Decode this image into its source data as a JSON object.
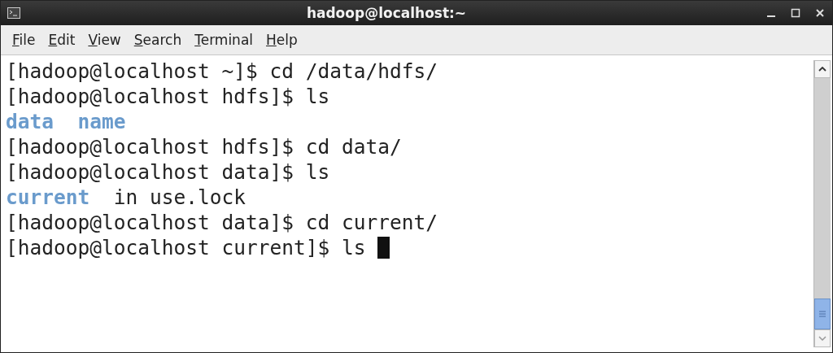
{
  "window": {
    "title": "hadoop@localhost:~"
  },
  "menu": [
    "File",
    "Edit",
    "View",
    "Search",
    "Terminal",
    "Help"
  ],
  "terminal": {
    "lines": [
      {
        "kind": "command",
        "text": "[hadoop@localhost ~]$ cd /data/hdfs/"
      },
      {
        "kind": "command",
        "text": "[hadoop@localhost hdfs]$ ls"
      },
      {
        "kind": "listing",
        "entries": [
          {
            "kind": "dir",
            "text": "data"
          },
          {
            "kind": "dir",
            "text": "name"
          }
        ]
      },
      {
        "kind": "command",
        "text": "[hadoop@localhost hdfs]$ cd data/"
      },
      {
        "kind": "command",
        "text": "[hadoop@localhost data]$ ls"
      },
      {
        "kind": "listing",
        "entries": [
          {
            "kind": "dir",
            "text": "current"
          },
          {
            "kind": "file",
            "text": "in use.lock"
          }
        ]
      },
      {
        "kind": "command",
        "text": "[hadoop@localhost data]$ cd current/"
      },
      {
        "kind": "command",
        "text": "[hadoop@localhost current]$ ls",
        "cursor": true
      }
    ]
  }
}
